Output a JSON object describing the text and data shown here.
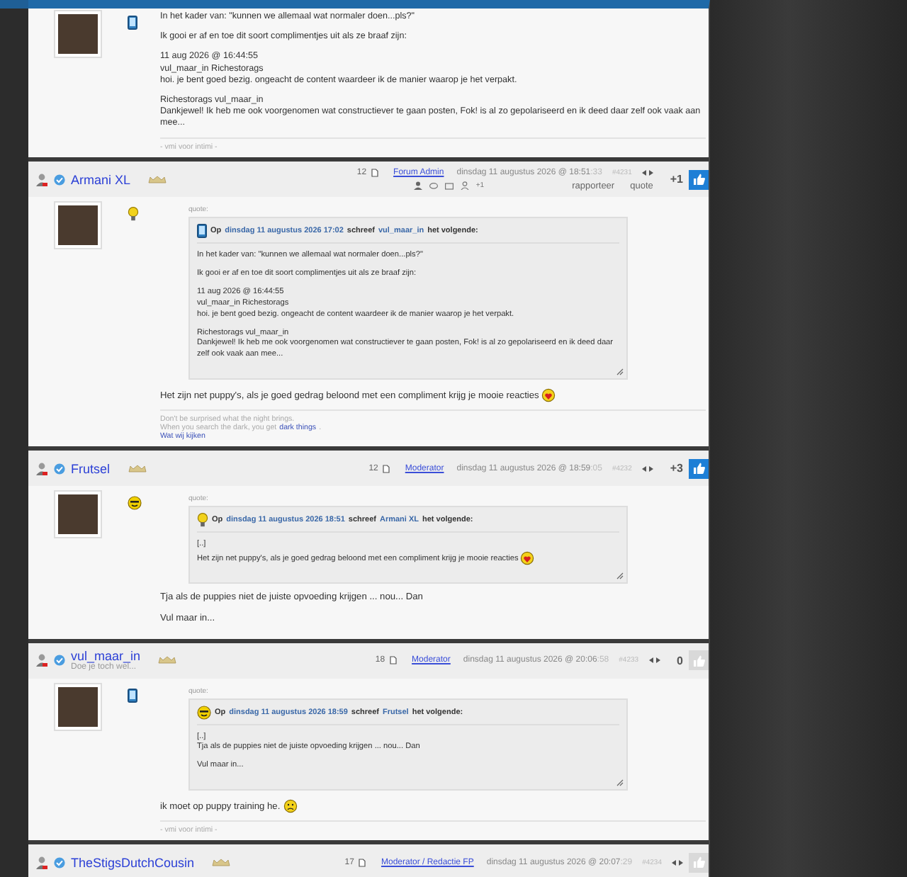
{
  "top_post": {
    "mood_icon": {
      "kind": "phone"
    },
    "paragraphs": [
      {
        "text": "In het kader van: \"kunnen we allemaal wat normaler doen...pls?\""
      },
      {
        "text": "Ik gooi er af en toe dit soort complimentjes uit als ze braaf zijn:"
      },
      {
        "text": "11 aug 2026 @ 16:44:55\nvul_maar_in Richestorags\nhoi. je bent goed bezig. ongeacht de content waardeer ik de manier waarop je het verpakt."
      },
      {
        "text": "Richestorags vul_maar_in\nDankjewel! Ik heb me ook voorgenomen wat constructiever te gaan posten, Fok! is al zo gepolariseerd en ik deed daar zelf ook vaak aan mee..."
      }
    ],
    "signature": [
      [
        {
          "text": "- vmi voor intimi -",
          "link": false
        }
      ]
    ]
  },
  "posts": [
    {
      "username": "Armani XL",
      "verified": true,
      "post_count": "12",
      "role": "Forum Admin",
      "date": "dinsdag 11 augustus 2026 @ 18:51",
      "seconds": ":33",
      "number": "#4231",
      "score": "+1",
      "vote_active": true,
      "tools_visible": true,
      "tool_count": "+1",
      "actions": [
        "rapporteer",
        "quote"
      ],
      "mood_icon": {
        "kind": "bulb"
      },
      "quote": {
        "label": "quote:",
        "mood_icon": {
          "kind": "phone"
        },
        "prefix": "Op",
        "date": "dinsdag 11 augustus 2026 17:02",
        "mid": "schreef",
        "author": "vul_maar_in",
        "suffix": "het volgende:",
        "paragraphs": [
          {
            "text": "In het kader van: \"kunnen we allemaal wat normaler doen...pls?\""
          },
          {
            "text": "Ik gooi er af en toe dit soort complimentjes uit als ze braaf zijn:"
          },
          {
            "text": "11 aug 2026 @ 16:44:55\nvul_maar_in Richestorags\nhoi. je bent goed bezig. ongeacht de content waardeer ik de manier waarop je het verpakt."
          },
          {
            "text": "Richestorags vul_maar_in\nDankjewel! Ik heb me ook voorgenomen wat constructiever te gaan posten, Fok! is al zo gepolariseerd en ik deed daar zelf ook vaak aan mee..."
          }
        ]
      },
      "paragraphs": [
        {
          "text": "Het zijn net puppy's, als je goed gedrag beloond met een compliment krijg je mooie reacties",
          "emoji": {
            "kind": "heart"
          }
        }
      ],
      "signature": [
        [
          {
            "text": "Don't be surprised what the night brings.",
            "link": false
          }
        ],
        [
          {
            "text": "When you search the dark, you get",
            "link": false
          },
          {
            "text": "dark things",
            "link": true
          },
          {
            "text": ".",
            "link": false
          }
        ],
        [
          {
            "text": "Wat wij kijken",
            "link": true
          }
        ]
      ]
    },
    {
      "username": "Frutsel",
      "verified": true,
      "post_count": "12",
      "role": "Moderator",
      "date": "dinsdag 11 augustus 2026 @ 18:59",
      "seconds": ":05",
      "number": "#4232",
      "score": "+3",
      "vote_active": true,
      "tools_visible": false,
      "mood_icon": {
        "kind": "smiley"
      },
      "quote": {
        "label": "quote:",
        "mood_icon": {
          "kind": "bulb"
        },
        "prefix": "Op",
        "date": "dinsdag 11 augustus 2026 18:51",
        "mid": "schreef",
        "author": "Armani XL",
        "suffix": "het volgende:",
        "paragraphs": [
          {
            "text": "[..]\nHet zijn net puppy's, als je goed gedrag beloond met een compliment krijg je mooie reacties",
            "emoji": {
              "kind": "heart"
            }
          }
        ]
      },
      "paragraphs": [
        {
          "text": "Tja als de puppies niet de juiste opvoeding krijgen ... nou... Dan"
        },
        {
          "text": "Vul maar in..."
        }
      ]
    },
    {
      "username": "vul_maar_in",
      "verified": true,
      "subtitle": "Doe je toch wel...",
      "post_count": "18",
      "role": "Moderator",
      "date": "dinsdag 11 augustus 2026 @ 20:06",
      "seconds": ":58",
      "number": "#4233",
      "score": "0",
      "vote_active": false,
      "tools_visible": false,
      "mood_icon": {
        "kind": "phone"
      },
      "quote": {
        "label": "quote:",
        "mood_icon": {
          "kind": "smiley"
        },
        "prefix": "Op",
        "date": "dinsdag 11 augustus 2026 18:59",
        "mid": "schreef",
        "author": "Frutsel",
        "suffix": "het volgende:",
        "paragraphs": [
          {
            "text": "[..]\nTja als de puppies niet de juiste opvoeding krijgen ... nou... Dan"
          },
          {
            "text": "Vul maar in..."
          }
        ]
      },
      "paragraphs": [
        {
          "text": "ik moet op puppy training he.",
          "emoji": {
            "kind": "sad"
          }
        }
      ],
      "signature": [
        [
          {
            "text": "- vmi voor intimi -",
            "link": false
          }
        ]
      ]
    },
    {
      "username": "TheStigsDutchCousin",
      "verified": true,
      "post_count": "17",
      "role": "Moderator / Redactie FP",
      "date": "dinsdag 11 augustus 2026 @ 20:07",
      "seconds": ":29",
      "number": "#4234",
      "vote_active": false,
      "tools_visible": false
    }
  ]
}
